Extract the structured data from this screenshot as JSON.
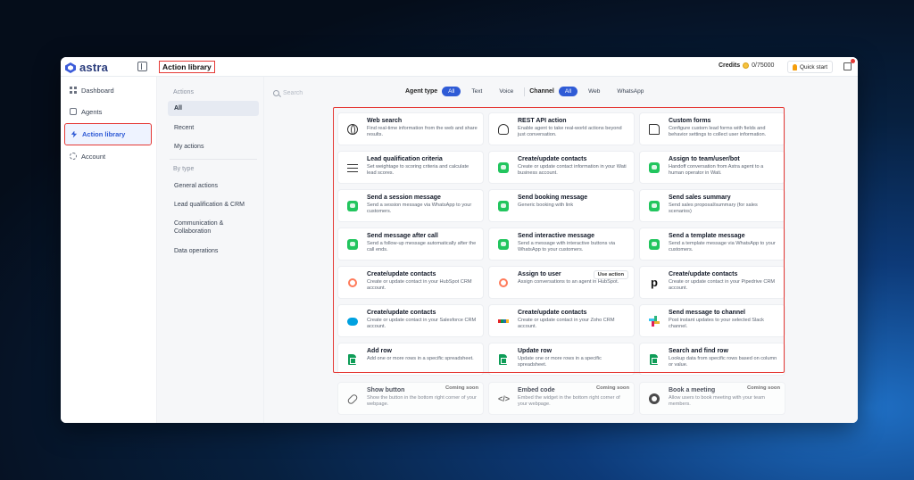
{
  "app": {
    "brand": "astra",
    "page_title": "Action library"
  },
  "topbar": {
    "credits_label": "Credits",
    "credits_count": "0/75000",
    "quick_start": "Quick start"
  },
  "nav": [
    {
      "label": "Dashboard",
      "icon": "dashboard-icon"
    },
    {
      "label": "Agents",
      "icon": "agents-icon"
    },
    {
      "label": "Action library",
      "icon": "bolt-icon",
      "active": true
    },
    {
      "label": "Account",
      "icon": "gear-icon"
    }
  ],
  "subnav": {
    "actions_heading": "Actions",
    "items": [
      "All",
      "Recent",
      "My actions"
    ],
    "by_type_heading": "By type",
    "types": [
      "General actions",
      "Lead qualification & CRM",
      "Communication & Collaboration",
      "Data operations"
    ]
  },
  "filters": {
    "search_placeholder": "Search",
    "agent_type_label": "Agent type",
    "agent_types": [
      "All",
      "Text",
      "Voice"
    ],
    "channel_label": "Channel",
    "channels": [
      "All",
      "Web",
      "WhatsApp"
    ]
  },
  "cards": [
    {
      "title": "Web search",
      "desc": "Find real-time information from the web and share results.",
      "icon": "globe-icon"
    },
    {
      "title": "REST API action",
      "desc": "Enable agent to take real-world actions beyond just conversation.",
      "icon": "webhook-icon"
    },
    {
      "title": "Custom forms",
      "desc": "Configure custom lead forms with fields and behavior settings to collect user information.",
      "icon": "form-icon"
    },
    {
      "title": "Lead qualification criteria",
      "desc": "Set weightage to scoring criteria and calculate lead scores.",
      "icon": "sliders-icon"
    },
    {
      "title": "Create/update contacts",
      "desc": "Create or update contact information in your Wati business account.",
      "icon": "wati-icon"
    },
    {
      "title": "Assign to team/user/bot",
      "desc": "Handoff conversation from Astra agent to a human operator in Wati.",
      "icon": "wati-icon"
    },
    {
      "title": "Send a session message",
      "desc": "Send a session message via WhatsApp to your customers.",
      "icon": "wati-icon"
    },
    {
      "title": "Send booking message",
      "desc": "Generic booking with link",
      "icon": "wati-icon"
    },
    {
      "title": "Send sales summary",
      "desc": "Send sales proposal/summary (for sales scenarios)",
      "icon": "wati-icon"
    },
    {
      "title": "Send message after call",
      "desc": "Send a follow-up message automatically after the call ends.",
      "icon": "wati-icon"
    },
    {
      "title": "Send interactive message",
      "desc": "Send a message with interactive buttons via WhatsApp to your customers.",
      "icon": "wati-icon"
    },
    {
      "title": "Send a template message",
      "desc": "Send a template message via WhatsApp to your customers.",
      "icon": "wati-icon"
    },
    {
      "title": "Create/update contacts",
      "desc": "Create or update contact in your HubSpot CRM account.",
      "icon": "hubspot-icon"
    },
    {
      "title": "Assign to user",
      "desc": "Assign conversations to an agent in HubSpot.",
      "icon": "hubspot-icon",
      "button": "Use action"
    },
    {
      "title": "Create/update contacts",
      "desc": "Create or update contact in your Pipedrive CRM account.",
      "icon": "pipedrive-icon"
    },
    {
      "title": "Create/update contacts",
      "desc": "Create or update contact in your Salesforce CRM account.",
      "icon": "salesforce-icon"
    },
    {
      "title": "Create/update contacts",
      "desc": "Create or update contact in your Zoho CRM account.",
      "icon": "zoho-icon"
    },
    {
      "title": "Send message to channel",
      "desc": "Post instant updates to your selected Slack channel.",
      "icon": "slack-icon"
    },
    {
      "title": "Add row",
      "desc": "Add one or more rows in a specific spreadsheet.",
      "icon": "sheets-icon"
    },
    {
      "title": "Update row",
      "desc": "Update one or more rows in a specific spreadsheet.",
      "icon": "sheets-icon"
    },
    {
      "title": "Search and find row",
      "desc": "Lookup data from specific rows based on column or value.",
      "icon": "sheets-icon"
    }
  ],
  "coming_soon_label": "Coming soon",
  "coming_cards": [
    {
      "title": "Show button",
      "desc": "Show the button in the bottom right corner of your webpage.",
      "icon": "link-icon"
    },
    {
      "title": "Embed code",
      "desc": "Embed the widget in the bottom right corner of your webpage.",
      "icon": "code-icon"
    },
    {
      "title": "Book a meeting",
      "desc": "Allow users to book meeting with your team members.",
      "icon": "calendar-icon"
    }
  ]
}
